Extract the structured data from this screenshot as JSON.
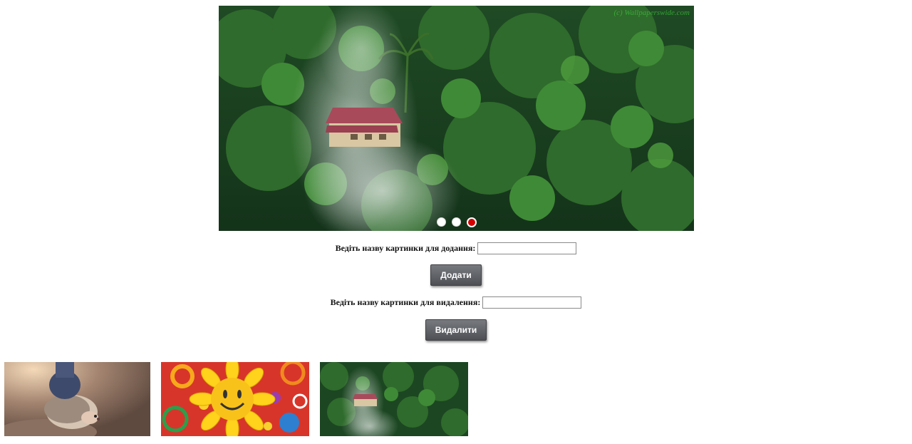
{
  "slider": {
    "watermark": "(c) Wallpaperswide.com",
    "dots": [
      {
        "name": "slide-dot-1",
        "active": false
      },
      {
        "name": "slide-dot-2",
        "active": false
      },
      {
        "name": "slide-dot-3",
        "active": true
      }
    ],
    "current_image": "forest-house-image"
  },
  "add_form": {
    "label": "Ведіть назву картинки для додання:",
    "value": "",
    "placeholder": "",
    "button_label": "Додати"
  },
  "delete_form": {
    "label": "Ведіть назву картинки для видалення:",
    "value": "",
    "placeholder": "",
    "button_label": "Видалити"
  },
  "thumbnails": [
    {
      "name": "hedgehog-image"
    },
    {
      "name": "sunflower-smiley-image"
    },
    {
      "name": "forest-house-image"
    }
  ],
  "colors": {
    "active_dot": "#d50000",
    "button_top": "#777a7f",
    "button_bottom": "#4e5055"
  }
}
